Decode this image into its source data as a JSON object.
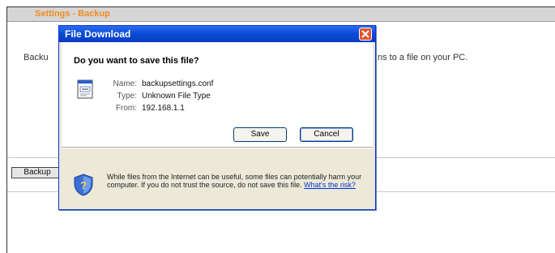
{
  "page": {
    "section_title": "Settings - Backup",
    "description_left": "Backu",
    "description_right": "ns to a file on your PC.",
    "backup_button": "Backup"
  },
  "dialog": {
    "title": "File Download",
    "question": "Do you want to save this file?",
    "file": {
      "name_label": "Name:",
      "name_value": "backupsettings.conf",
      "type_label": "Type:",
      "type_value": "Unknown File Type",
      "from_label": "From:",
      "from_value": "192.168.1.1"
    },
    "save_button": "Save",
    "cancel_button": "Cancel",
    "warning_text": "While files from the Internet can be useful, some files can potentially harm your computer. If you do not trust the source, do not save this file.",
    "risk_link": "What's the risk?"
  },
  "colors": {
    "title_orange": "#f08a1e",
    "dialog_blue": "#0a4ad6",
    "dialog_bg": "#ece9d8"
  },
  "icons": {
    "file": "generic-file-icon",
    "shield": "security-shield-icon",
    "close": "close-icon"
  }
}
